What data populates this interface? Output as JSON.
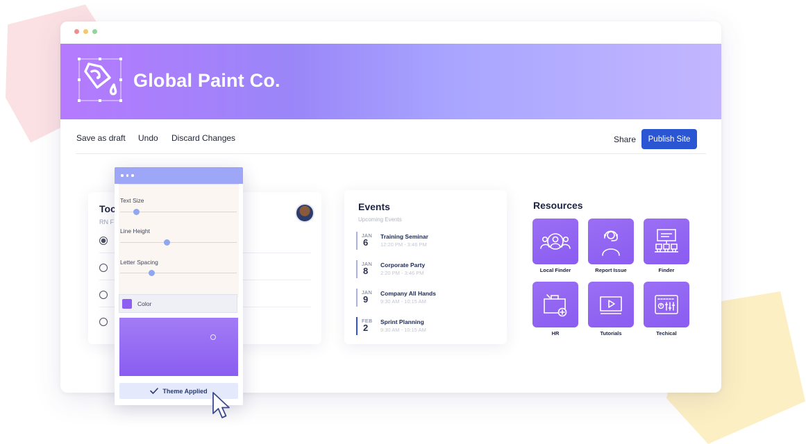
{
  "brand": {
    "name": "Global Paint Co."
  },
  "toolbar": {
    "save_draft": "Save as draft",
    "undo": "Undo",
    "discard": "Discard Changes",
    "share": "Share",
    "publish": "Publish Site"
  },
  "todo": {
    "title": "Toc",
    "subtitle": "RN F",
    "items": [
      {
        "label": "",
        "checked": true
      },
      {
        "label": "",
        "checked": false
      },
      {
        "label": "",
        "checked": false
      },
      {
        "label": "",
        "checked": false
      }
    ]
  },
  "events": {
    "title": "Events",
    "subtitle": "Upcoming Events",
    "items": [
      {
        "month": "JAN",
        "day": "6",
        "name": "Training Seminar",
        "time": "12:20 PM - 3:46 PM",
        "active": false
      },
      {
        "month": "JAN",
        "day": "8",
        "name": "Corporate Party",
        "time": "2:20 PM - 3:46 PM",
        "active": false
      },
      {
        "month": "JAN",
        "day": "9",
        "name": "Company All Hands",
        "time": "9:30 AM - 10:15 AM",
        "active": false
      },
      {
        "month": "FEB",
        "day": "2",
        "name": "Sprint Planning",
        "time": "9:30 AM - 10:15 AM",
        "active": true
      }
    ]
  },
  "resources": {
    "title": "Resources",
    "items": [
      {
        "label": "Local Finder",
        "icon": "people-search-icon"
      },
      {
        "label": "Report Issue",
        "icon": "support-agent-icon"
      },
      {
        "label": "Finder",
        "icon": "training-room-icon"
      },
      {
        "label": "HR",
        "icon": "briefcase-plus-icon"
      },
      {
        "label": "Tutorials",
        "icon": "video-play-icon"
      },
      {
        "label": "Techical",
        "icon": "control-panel-icon"
      }
    ]
  },
  "theme_panel": {
    "text_size_label": "Text Size",
    "line_height_label": "Line Height",
    "letter_spacing_label": "Letter Spacing",
    "text_size_value": 0.14,
    "line_height_value": 0.4,
    "letter_spacing_value": 0.27,
    "color_label": "Color",
    "color_value": "#8e5df2",
    "applied_label": "Theme Applied"
  },
  "colors": {
    "accent": "#2a55d3",
    "brand_purple": "#8e5df2",
    "window_dot_red": "#f08c92",
    "window_dot_yellow": "#f3c873",
    "window_dot_green": "#8fd69a"
  }
}
